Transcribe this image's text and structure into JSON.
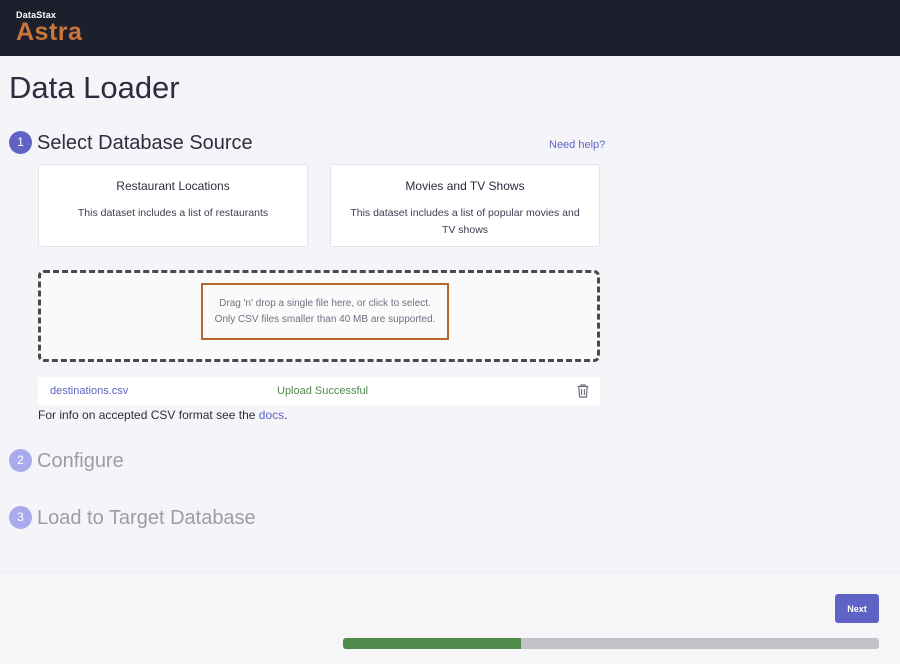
{
  "header": {
    "brand_small": "DataStax",
    "brand_big": "Astra"
  },
  "page": {
    "title": "Data Loader"
  },
  "steps": [
    {
      "number": "1",
      "title": "Select Database Source",
      "state": "active"
    },
    {
      "number": "2",
      "title": "Configure",
      "state": "inactive"
    },
    {
      "number": "3",
      "title": "Load to Target Database",
      "state": "inactive"
    }
  ],
  "help_link": "Need help?",
  "datasets": [
    {
      "title": "Restaurant Locations",
      "description": "This dataset includes a list of restaurants"
    },
    {
      "title": "Movies and TV Shows",
      "description": "This dataset includes a list of popular movies and TV shows"
    }
  ],
  "dropzone": {
    "line1": "Drag 'n' drop a single file here, or click to select.",
    "line2": "Only CSV files smaller than 40 MB are supported."
  },
  "uploaded_file": {
    "name": "destinations.csv",
    "status": "Upload Successful",
    "action_icon": "trash-icon"
  },
  "info": {
    "prefix": "For info on accepted CSV format see the ",
    "link": "docs",
    "suffix": "."
  },
  "footer": {
    "next_label": "Next",
    "progress_fraction": 0.333
  },
  "colors": {
    "accent": "#5f63c5",
    "success": "#4f8a4c",
    "brand": "#c8763a",
    "header_bg": "#1e1f2d"
  }
}
